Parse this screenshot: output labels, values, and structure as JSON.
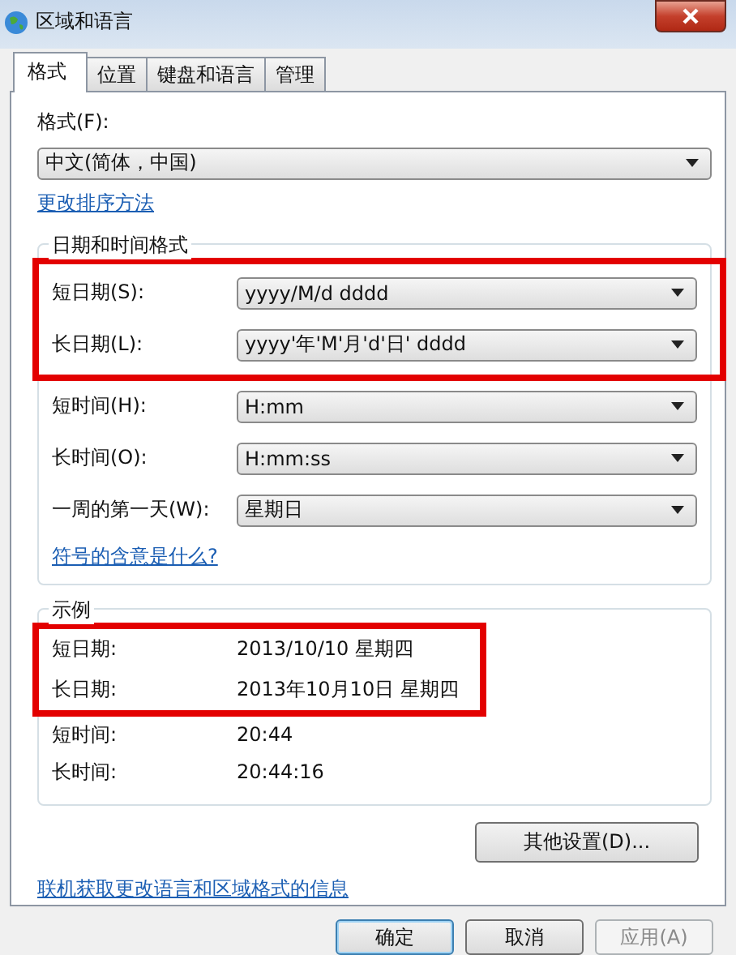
{
  "window": {
    "title": "区域和语言"
  },
  "tabs": [
    {
      "label": "格式",
      "selected": true
    },
    {
      "label": "位置",
      "selected": false
    },
    {
      "label": "键盘和语言",
      "selected": false
    },
    {
      "label": "管理",
      "selected": false
    }
  ],
  "format": {
    "label": "格式(F):",
    "value": "中文(简体，中国)"
  },
  "sort_link": "更改排序方法",
  "date_time_formats": {
    "title": "日期和时间格式",
    "rows": [
      {
        "label": "短日期(S):",
        "value": "yyyy/M/d dddd",
        "highlighted": true
      },
      {
        "label": "长日期(L):",
        "value": "yyyy'年'M'月'd'日' dddd",
        "highlighted": true
      },
      {
        "label": "短时间(H):",
        "value": "H:mm",
        "highlighted": false
      },
      {
        "label": "长时间(O):",
        "value": "H:mm:ss",
        "highlighted": false
      },
      {
        "label": "一周的第一天(W):",
        "value": "星期日",
        "highlighted": false
      }
    ],
    "link": "符号的含意是什么?"
  },
  "examples": {
    "title": "示例",
    "rows": [
      {
        "label": "短日期:",
        "value": "2013/10/10 星期四",
        "highlighted": true
      },
      {
        "label": "长日期:",
        "value": "2013年10月10日 星期四",
        "highlighted": true
      },
      {
        "label": "短时间:",
        "value": "20:44",
        "highlighted": false
      },
      {
        "label": "长时间:",
        "value": "20:44:16",
        "highlighted": false
      }
    ]
  },
  "other_settings_button": "其他设置(D)...",
  "online_link": "联机获取更改语言和区域格式的信息",
  "buttons": [
    {
      "label": "确定",
      "kind": "default",
      "disabled": false
    },
    {
      "label": "取消",
      "kind": "normal",
      "disabled": false
    },
    {
      "label": "应用(A)",
      "kind": "normal",
      "disabled": true
    }
  ]
}
